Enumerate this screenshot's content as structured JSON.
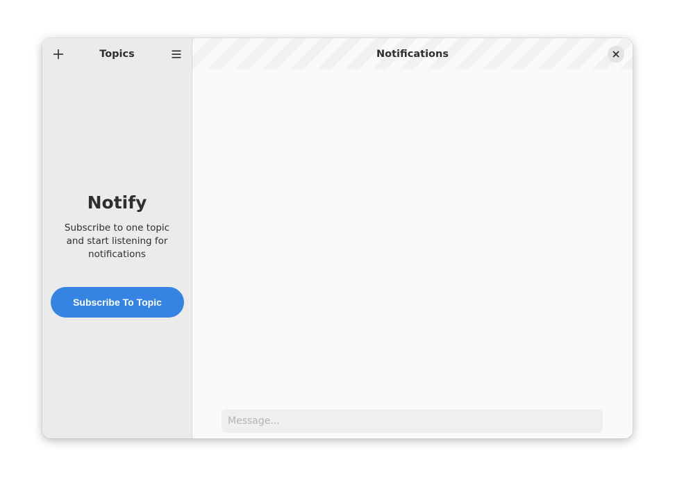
{
  "sidebar": {
    "title": "Topics",
    "add_icon": "plus-icon",
    "menu_icon": "hamburger-menu-icon",
    "status": {
      "title": "Notify",
      "description": "Subscribe to one topic and start listening for notifications"
    },
    "subscribe_button": "Subscribe To Topic"
  },
  "main": {
    "title": "Notifications",
    "close_icon": "close-icon",
    "message_placeholder": "Message..."
  },
  "colors": {
    "accent": "#3584e4",
    "sidebar_bg": "#ebebeb",
    "content_bg": "#fafafa"
  }
}
